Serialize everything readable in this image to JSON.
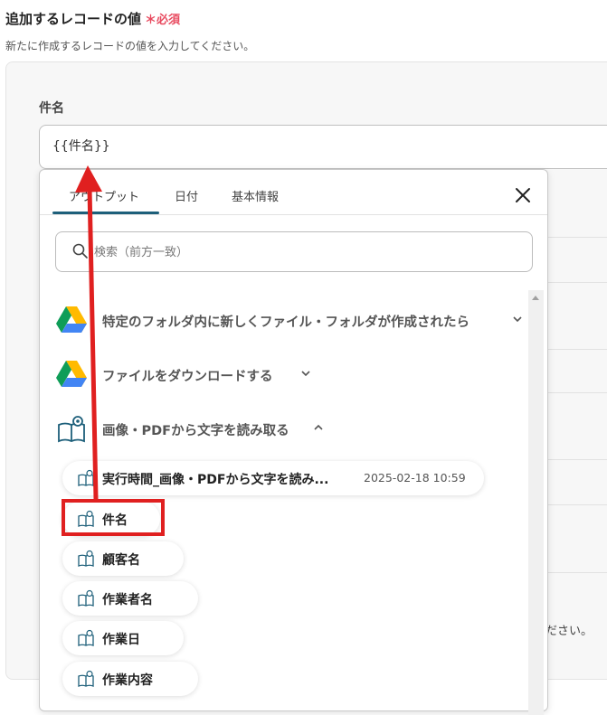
{
  "section": {
    "title": "追加するレコードの値",
    "required": "＊必須",
    "description": "新たに作成するレコードの値を入力してください。"
  },
  "field": {
    "label": "件名",
    "value": "{{件名}}"
  },
  "background": {
    "tail_text": "ださい。"
  },
  "dropdown": {
    "tabs": [
      "アウトプット",
      "日付",
      "基本情報"
    ],
    "active_tab": "アウトプット",
    "search_placeholder": "検索（前方一致）",
    "groups": [
      {
        "label": "特定のフォルダ内に新しくファイル・フォルダが作成されたら",
        "icon": "google-drive-icon",
        "expanded": false
      },
      {
        "label": "ファイルをダウンロードする",
        "icon": "google-drive-icon",
        "expanded": false
      },
      {
        "label": "画像・PDFから文字を読み取る",
        "icon": "ocr-book-icon",
        "expanded": true
      }
    ],
    "items": [
      {
        "label": "実行時間_画像・PDFから文字を読み...",
        "date": "2025-02-18 10:59"
      },
      {
        "label": "件名"
      },
      {
        "label": "顧客名"
      },
      {
        "label": "作業者名"
      },
      {
        "label": "作業日"
      },
      {
        "label": "作業内容"
      }
    ]
  },
  "colors": {
    "accent": "#1d5f7a",
    "required": "#e84a5f",
    "annotation": "#e02020"
  }
}
